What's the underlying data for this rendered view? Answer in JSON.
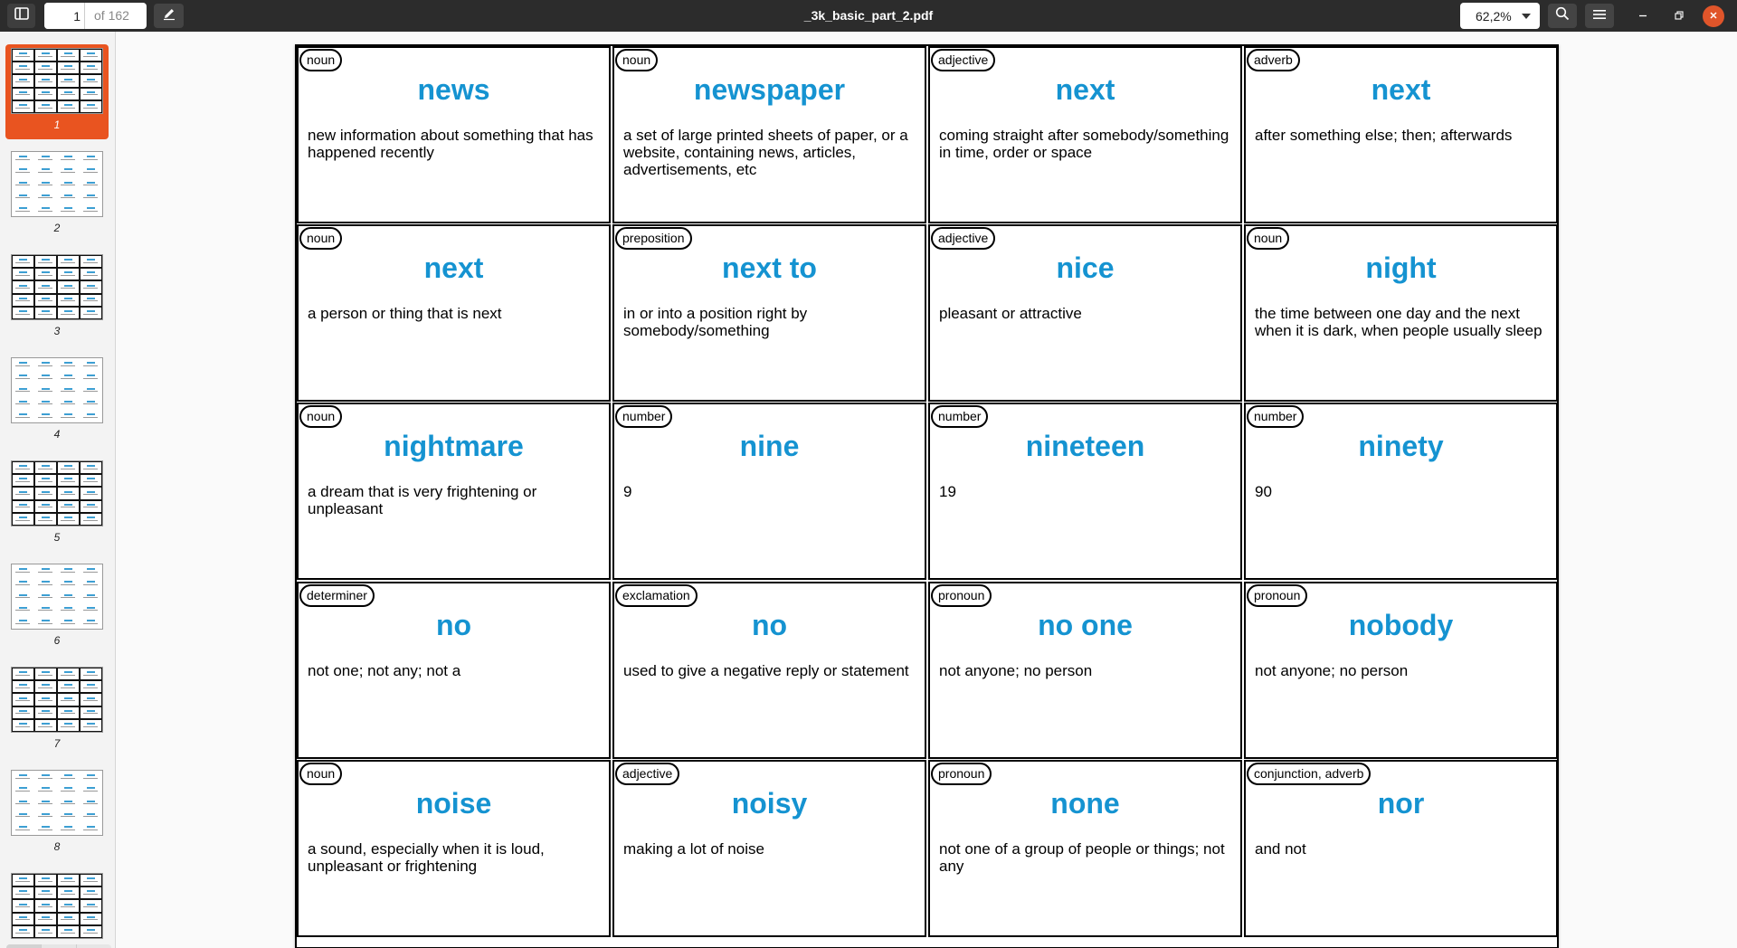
{
  "header": {
    "sidebar_toggle_icon": "sidebar-icon",
    "page_current": "1",
    "page_total": "of 162",
    "annotate_icon": "pencil-icon",
    "title": "_3k_basic_part_2.pdf",
    "zoom": "62,2%",
    "search_icon": "search-icon",
    "menu_icon": "hamburger-menu-icon",
    "minimize_icon": "minimize-icon",
    "maximize_icon": "maximize-icon",
    "close_icon": "close-icon",
    "close_color": "#e0552a"
  },
  "sidebar": {
    "selected_color": "#e95420",
    "thumbnails": [
      {
        "label": "1",
        "selected": true
      },
      {
        "label": "2",
        "selected": false
      },
      {
        "label": "3",
        "selected": false
      },
      {
        "label": "4",
        "selected": false
      },
      {
        "label": "5",
        "selected": false
      },
      {
        "label": "6",
        "selected": false
      },
      {
        "label": "7",
        "selected": false
      },
      {
        "label": "8",
        "selected": false
      },
      {
        "label": "",
        "selected": false
      }
    ],
    "tools": [
      "thumbnails-grid-icon",
      "annotations-icon",
      "bookmarks-icon"
    ]
  },
  "page": {
    "word_color": "#1593d1",
    "cards": [
      {
        "pos": "noun",
        "word": "news",
        "def": "new information about something that has happened recently"
      },
      {
        "pos": "noun",
        "word": "newspaper",
        "def": "a set of large printed sheets of paper, or a website, containing news, articles, advertisements, etc"
      },
      {
        "pos": "adjective",
        "word": "next",
        "def": "coming straight after somebody/something in time, order or space"
      },
      {
        "pos": "adverb",
        "word": "next",
        "def": "after something else; then; afterwards"
      },
      {
        "pos": "noun",
        "word": "next",
        "def": "a person or thing that is next"
      },
      {
        "pos": "preposition",
        "word": "next to",
        "def": "in or into a position right by somebody/something"
      },
      {
        "pos": "adjective",
        "word": "nice",
        "def": "pleasant or attractive"
      },
      {
        "pos": "noun",
        "word": "night",
        "def": "the time between one day and the next when it is dark, when people usually sleep"
      },
      {
        "pos": "noun",
        "word": "nightmare",
        "def": "a dream that is very frightening or unpleasant"
      },
      {
        "pos": "number",
        "word": "nine",
        "def": "9"
      },
      {
        "pos": "number",
        "word": "nineteen",
        "def": "19"
      },
      {
        "pos": "number",
        "word": "ninety",
        "def": "90"
      },
      {
        "pos": "determiner",
        "word": "no",
        "def": "not one; not any; not a"
      },
      {
        "pos": "exclamation",
        "word": "no",
        "def": "used to give a negative reply or statement"
      },
      {
        "pos": "pronoun",
        "word": "no one",
        "def": "not anyone; no person"
      },
      {
        "pos": "pronoun",
        "word": "nobody",
        "def": "not anyone; no person"
      },
      {
        "pos": "noun",
        "word": "noise",
        "def": "a sound, especially when it is loud, unpleasant or frightening"
      },
      {
        "pos": "adjective",
        "word": "noisy",
        "def": "making a lot of noise"
      },
      {
        "pos": "pronoun",
        "word": "none",
        "def": "not one of a group of people or things; not any"
      },
      {
        "pos": "conjunction, adverb",
        "word": "nor",
        "def": "and not"
      }
    ]
  }
}
